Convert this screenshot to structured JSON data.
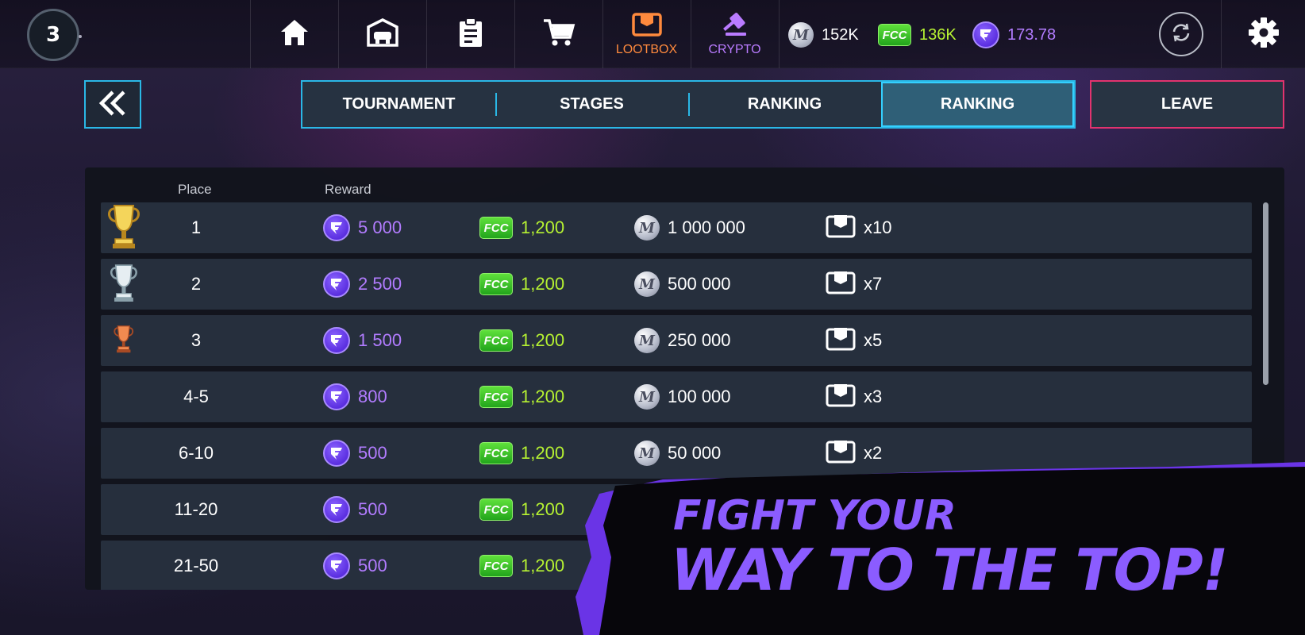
{
  "topbar": {
    "level": "3",
    "nav": [
      {
        "icon": "home-icon",
        "label": ""
      },
      {
        "icon": "garage-icon",
        "label": ""
      },
      {
        "icon": "clipboard-icon",
        "label": ""
      },
      {
        "icon": "cart-icon",
        "label": ""
      },
      {
        "icon": "lootbox-icon",
        "label": "LOOTBOX",
        "color": "#ff8a3d"
      },
      {
        "icon": "crypto-gavel-icon",
        "label": "CRYPTO",
        "color": "#b97bff"
      }
    ],
    "currencies": {
      "m_coins": "152K",
      "fcc": "136K",
      "fv": "173.78"
    },
    "colors": {
      "fcc_text": "#b6f232",
      "fv_text": "#b27cff",
      "m_text": "#ffffff"
    }
  },
  "tabs": {
    "items": [
      "TOURNAMENT",
      "STAGES",
      "RANKING",
      "RANKING"
    ],
    "active_index": 3,
    "leave_label": "LEAVE",
    "accent": "#2ab8e6",
    "leave_border": "#e2336e"
  },
  "table": {
    "headers": {
      "place": "Place",
      "reward": "Reward"
    },
    "rows": [
      {
        "place": "1",
        "trophy": "gold-trophy-icon",
        "fv": "5 000",
        "fcc": "1,200",
        "m": "1 000 000",
        "box": "x10"
      },
      {
        "place": "2",
        "trophy": "silver-trophy-icon",
        "fv": "2 500",
        "fcc": "1,200",
        "m": "500 000",
        "box": "x7"
      },
      {
        "place": "3",
        "trophy": "bronze-trophy-icon",
        "fv": "1 500",
        "fcc": "1,200",
        "m": "250 000",
        "box": "x5"
      },
      {
        "place": "4-5",
        "trophy": "",
        "fv": "800",
        "fcc": "1,200",
        "m": "100 000",
        "box": "x3"
      },
      {
        "place": "6-10",
        "trophy": "",
        "fv": "500",
        "fcc": "1,200",
        "m": "50 000",
        "box": "x2"
      },
      {
        "place": "11-20",
        "trophy": "",
        "fv": "500",
        "fcc": "1,200",
        "m": "",
        "box": ""
      },
      {
        "place": "21-50",
        "trophy": "",
        "fv": "500",
        "fcc": "1,200",
        "m": "",
        "box": ""
      }
    ]
  },
  "promo": {
    "line1": "FIGHT YOUR",
    "line2": "WAY TO THE TOP!",
    "color": "#8b5cff"
  }
}
